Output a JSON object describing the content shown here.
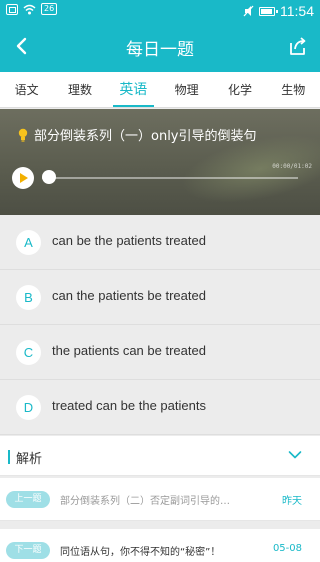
{
  "status_bar": {
    "badge": "26",
    "time": "11:54",
    "battery_level": 0.85
  },
  "header": {
    "title": "每日一题"
  },
  "tabs": [
    {
      "label": "语文"
    },
    {
      "label": "理数"
    },
    {
      "label": "英语"
    },
    {
      "label": "物理"
    },
    {
      "label": "化学"
    },
    {
      "label": "生物"
    }
  ],
  "active_tab": 2,
  "audio": {
    "title": "部分倒装系列（一）only引导的倒装句",
    "time": "00:00/01:02",
    "progress": 0.0
  },
  "options": [
    {
      "letter": "A",
      "text": "can be the patients treated"
    },
    {
      "letter": "B",
      "text": "can the patients be treated"
    },
    {
      "letter": "C",
      "text": "the patients can be treated"
    },
    {
      "letter": "D",
      "text": "treated can be the patients"
    }
  ],
  "analysis": {
    "label": "解析"
  },
  "nav": {
    "prev": {
      "pill": "上一题",
      "text": "部分倒装系列（二）否定副词引导的…",
      "date": "昨天"
    },
    "next": {
      "pill": "下一题",
      "text": "同位语从句，你不得不知的“秘密”！",
      "date": "05-08"
    }
  },
  "colors": {
    "accent": "#19b9c8",
    "pill": "#9fdfe6",
    "play_icon": "#f2b000"
  }
}
